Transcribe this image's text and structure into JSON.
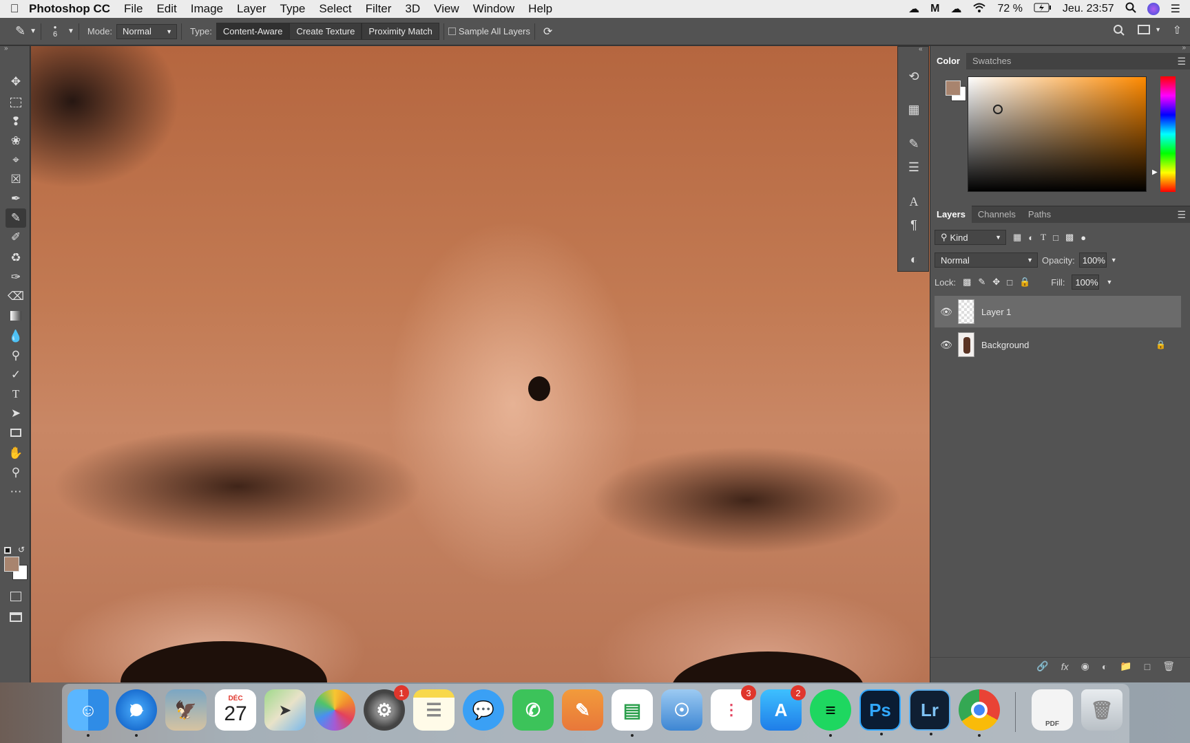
{
  "menubar": {
    "app_name": "Photoshop CC",
    "menus": [
      "File",
      "Edit",
      "Image",
      "Layer",
      "Type",
      "Select",
      "Filter",
      "3D",
      "View",
      "Window",
      "Help"
    ],
    "battery": "72 %",
    "clock": "Jeu. 23:57"
  },
  "options": {
    "brush_size": "6",
    "mode_label": "Mode:",
    "mode_value": "Normal",
    "type_label": "Type:",
    "type_buttons": [
      "Content-Aware",
      "Create Texture",
      "Proximity Match"
    ],
    "sample_all_layers": "Sample All Layers"
  },
  "color_panel": {
    "tabs": [
      "Color",
      "Swatches"
    ],
    "foreground": "#a8846e",
    "background": "#ffffff"
  },
  "layers_panel": {
    "tabs": [
      "Layers",
      "Channels",
      "Paths"
    ],
    "filter_kind": "Kind",
    "blend_mode": "Normal",
    "opacity_label": "Opacity:",
    "opacity": "100%",
    "lock_label": "Lock:",
    "fill_label": "Fill:",
    "fill": "100%",
    "layers": [
      {
        "name": "Layer 1",
        "selected": true,
        "locked": false
      },
      {
        "name": "Background",
        "selected": false,
        "locked": true
      }
    ]
  },
  "dock": {
    "calendar_month": "DÉC",
    "calendar_day": "27",
    "badges": {
      "system_preferences": "1",
      "reminders": "3",
      "app_store": "2"
    },
    "ps_label": "Ps",
    "lr_label": "Lr",
    "pdf_label": "PDF"
  }
}
